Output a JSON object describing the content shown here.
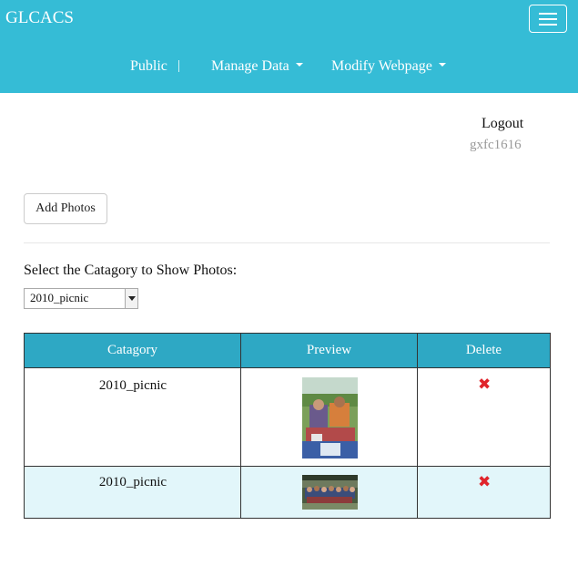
{
  "navbar": {
    "brand": "GLCACS",
    "toggle_icon": "hamburger-menu-icon",
    "items": [
      {
        "label": "Public"
      },
      {
        "label": "Manage Data"
      },
      {
        "label": "Modify Webpage"
      }
    ],
    "separator": "|",
    "color": "#35bcd6"
  },
  "user": {
    "logout_label": "Logout",
    "username": "gxfc1616"
  },
  "toolbar": {
    "add_photos_label": "Add Photos"
  },
  "filter": {
    "label": "Select the Catagory to Show Photos:",
    "selected": "2010_picnic"
  },
  "table": {
    "header_color": "#2ea8c4",
    "columns": [
      "Catagory",
      "Preview",
      "Delete"
    ],
    "rows": [
      {
        "category": "2010_picnic",
        "preview": "picnic-photo-portrait",
        "delete_icon": "red-x-icon"
      },
      {
        "category": "2010_picnic",
        "preview": "group-photo-landscape",
        "delete_icon": "red-x-icon"
      }
    ]
  }
}
